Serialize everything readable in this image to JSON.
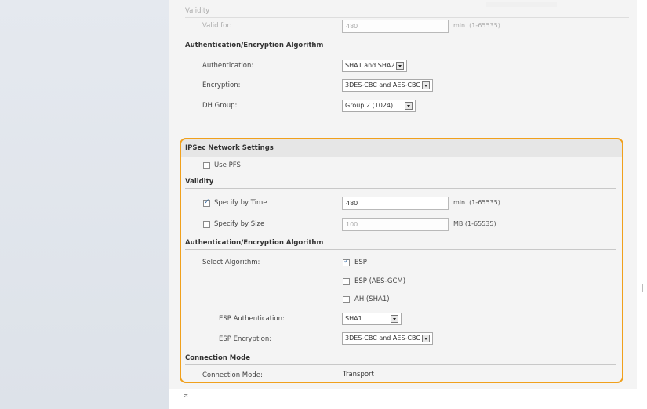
{
  "upper": {
    "validity_header": "Validity",
    "valid_for_label": "Valid for:",
    "valid_for_value": "480",
    "valid_for_unit": "min. (1-65535)",
    "auth_enc_header": "Authentication/Encryption Algorithm",
    "authentication_label": "Authentication:",
    "authentication_value": "SHA1 and SHA2",
    "encryption_label": "Encryption:",
    "encryption_value": "3DES-CBC and AES-CBC",
    "dh_group_label": "DH Group:",
    "dh_group_value": "Group 2 (1024)"
  },
  "ipsec": {
    "section_title": "IPSec Network Settings",
    "use_pfs_label": "Use PFS",
    "use_pfs_checked": false,
    "validity_header": "Validity",
    "specify_by_time_label": "Specify by Time",
    "specify_by_time_checked": true,
    "time_value": "480",
    "time_unit": "min. (1-65535)",
    "specify_by_size_label": "Specify by Size",
    "specify_by_size_checked": false,
    "size_value": "100",
    "size_unit": "MB (1-65535)",
    "auth_enc_header": "Authentication/Encryption Algorithm",
    "select_algorithm_label": "Select Algorithm:",
    "esp_label": "ESP",
    "esp_checked": true,
    "esp_aes_gcm_label": "ESP (AES-GCM)",
    "esp_aes_gcm_checked": false,
    "ah_sha1_label": "AH (SHA1)",
    "ah_sha1_checked": false,
    "esp_auth_label": "ESP Authentication:",
    "esp_auth_value": "SHA1",
    "esp_enc_label": "ESP Encryption:",
    "esp_enc_value": "3DES-CBC and AES-CBC",
    "connection_mode_header": "Connection Mode",
    "connection_mode_label": "Connection Mode:",
    "connection_mode_value": "Transport"
  },
  "footer": {
    "mark": "⌅"
  },
  "colors": {
    "highlight": "#f0a01c",
    "sidebar": "#e1e6ec",
    "panel": "#f4f4f4"
  }
}
